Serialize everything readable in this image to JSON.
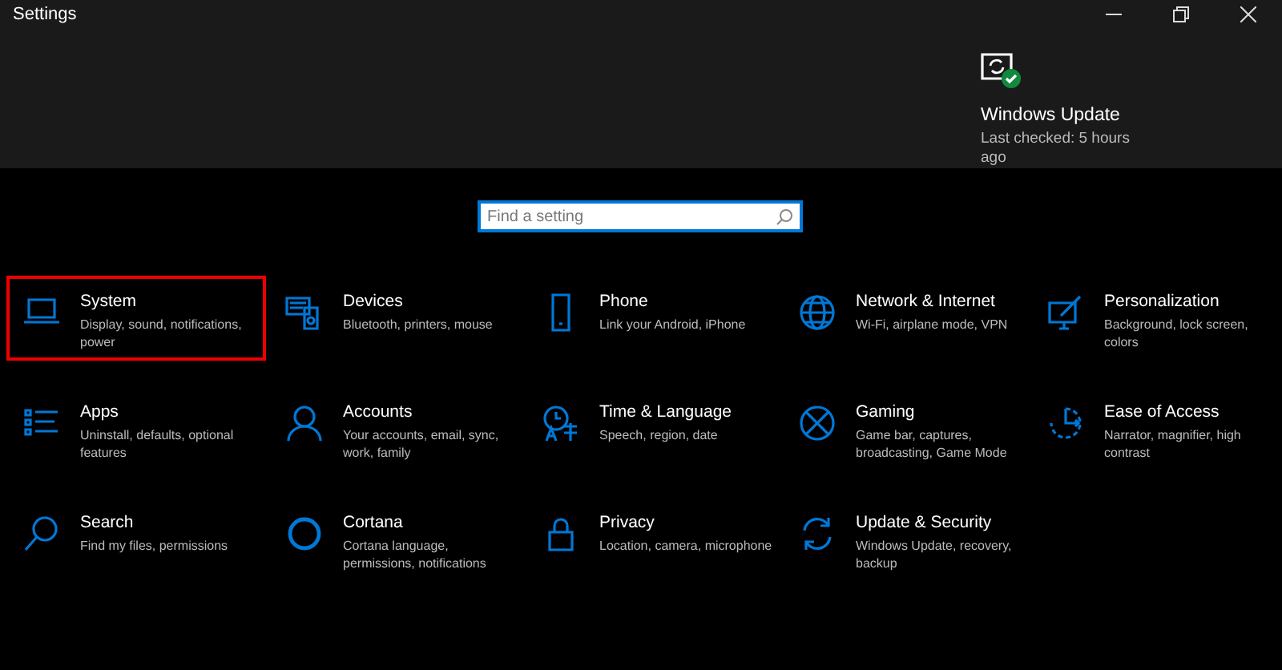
{
  "window": {
    "title": "Settings"
  },
  "update_tile": {
    "title": "Windows Update",
    "status": "Last checked: 5 hours ago"
  },
  "search": {
    "placeholder": "Find a setting"
  },
  "categories": [
    {
      "name": "System",
      "description": "Display, sound, notifications, power",
      "selected": true
    },
    {
      "name": "Devices",
      "description": "Bluetooth, printers, mouse",
      "selected": false
    },
    {
      "name": "Phone",
      "description": "Link your Android, iPhone",
      "selected": false
    },
    {
      "name": "Network & Internet",
      "description": "Wi-Fi, airplane mode, VPN",
      "selected": false
    },
    {
      "name": "Personalization",
      "description": "Background, lock screen, colors",
      "selected": false
    },
    {
      "name": "Apps",
      "description": "Uninstall, defaults, optional features",
      "selected": false
    },
    {
      "name": "Accounts",
      "description": "Your accounts, email, sync, work, family",
      "selected": false
    },
    {
      "name": "Time & Language",
      "description": "Speech, region, date",
      "selected": false
    },
    {
      "name": "Gaming",
      "description": "Game bar, captures, broadcasting, Game Mode",
      "selected": false
    },
    {
      "name": "Ease of Access",
      "description": "Narrator, magnifier, high contrast",
      "selected": false
    },
    {
      "name": "Search",
      "description": "Find my files, permissions",
      "selected": false
    },
    {
      "name": "Cortana",
      "description": "Cortana language, permissions, notifications",
      "selected": false
    },
    {
      "name": "Privacy",
      "description": "Location, camera, microphone",
      "selected": false
    },
    {
      "name": "Update & Security",
      "description": "Windows Update, recovery, backup",
      "selected": false
    }
  ]
}
